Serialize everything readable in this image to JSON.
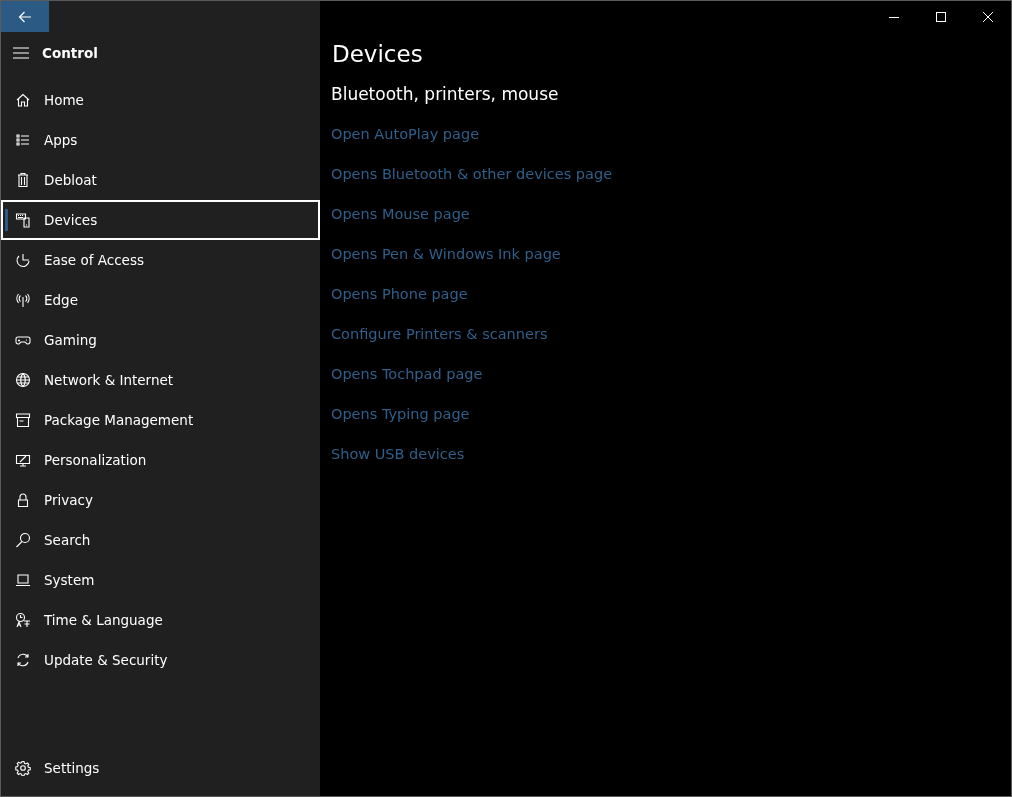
{
  "sidebar": {
    "title": "Control",
    "items": [
      {
        "label": "Home",
        "selected": false
      },
      {
        "label": "Apps",
        "selected": false
      },
      {
        "label": "Debloat",
        "selected": false
      },
      {
        "label": "Devices",
        "selected": true
      },
      {
        "label": "Ease of Access",
        "selected": false
      },
      {
        "label": "Edge",
        "selected": false
      },
      {
        "label": "Gaming",
        "selected": false
      },
      {
        "label": "Network & Internet",
        "selected": false
      },
      {
        "label": "Package Management",
        "selected": false
      },
      {
        "label": "Personalization",
        "selected": false
      },
      {
        "label": "Privacy",
        "selected": false
      },
      {
        "label": "Search",
        "selected": false
      },
      {
        "label": "System",
        "selected": false
      },
      {
        "label": "Time & Language",
        "selected": false
      },
      {
        "label": "Update & Security",
        "selected": false
      }
    ],
    "footer": {
      "label": "Settings"
    }
  },
  "page": {
    "title": "Devices",
    "subtitle": "Bluetooth, printers, mouse",
    "links": [
      "Open AutoPlay page",
      "Opens Bluetooth & other devices page",
      "Opens Mouse page",
      "Opens Pen & Windows Ink page",
      "Opens Phone page",
      "Configure Printers & scanners",
      "Opens Tochpad page",
      "Opens Typing page",
      "Show USB devices"
    ]
  }
}
